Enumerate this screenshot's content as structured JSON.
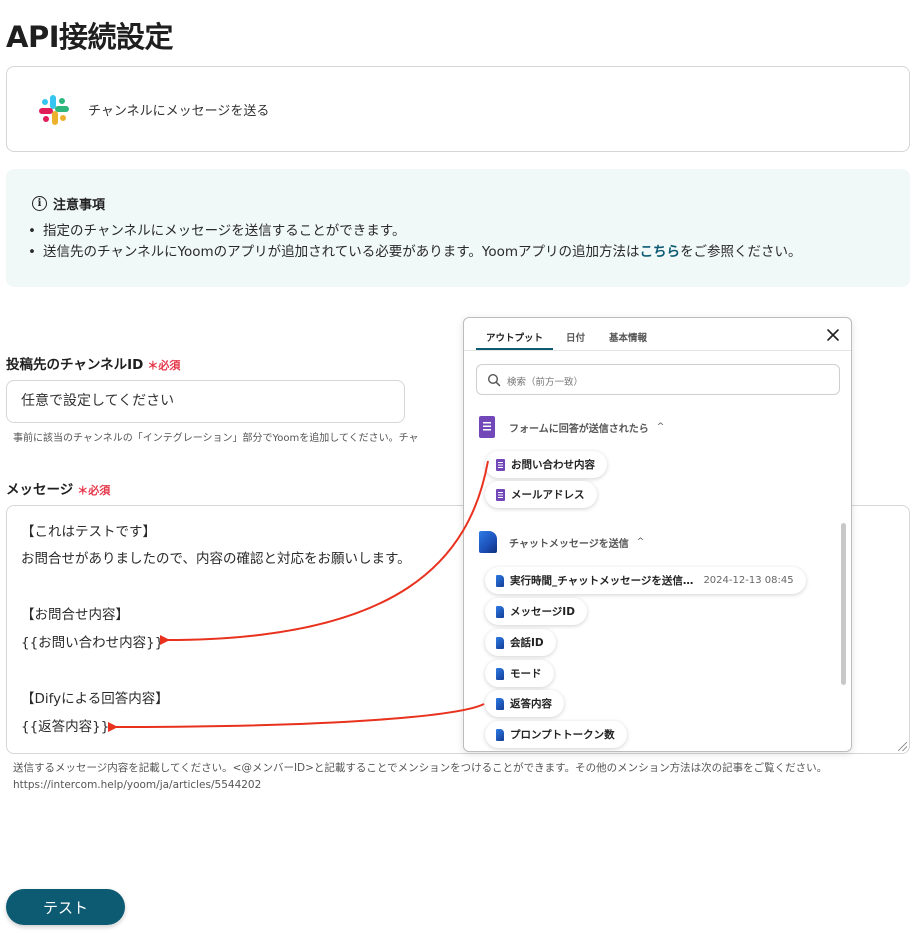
{
  "page": {
    "title": "API接続設定"
  },
  "action": {
    "label": "チャンネルにメッセージを送る",
    "logo": "slack-logo"
  },
  "notice": {
    "title": "注意事項",
    "item1": "指定のチャンネルにメッセージを送信することができます。",
    "item2_before": "送信先のチャンネルにYoomのアプリが追加されている必要があります。Yoomアプリの追加方法は",
    "item2_link": "こちら",
    "item2_after": "をご参照ください。"
  },
  "channel_field": {
    "label": "投稿先のチャンネルID",
    "required": "必須",
    "value": "任意で設定してください",
    "help": "事前に該当のチャンネルの「インテグレーション」部分でYoomを追加してください。チャ"
  },
  "message_field": {
    "label": "メッセージ",
    "required": "必須",
    "lines": [
      "【これはテストです】",
      "お問合せがありましたので、内容の確認と対応をお願いします。",
      "【お問合せ内容】",
      "{{お問い合わせ内容}}",
      "【Difyによる回答内容】",
      "{{返答内容}}"
    ],
    "help1": "送信するメッセージ内容を記載してください。<@メンバーID>と記載することでメンションをつけることができます。その他のメンション方法は次の記事をご覧ください。",
    "help2": "https://intercom.help/yoom/ja/articles/5544202"
  },
  "test_button": {
    "label": "テスト"
  },
  "picker": {
    "tabs": [
      "アウトプット",
      "日付",
      "基本情報"
    ],
    "search_placeholder": "検索（前方一致）",
    "sections": [
      {
        "title": "フォームに回答が送信されたら",
        "chevron": "^",
        "items": [
          {
            "label": "お問い合わせ内容"
          },
          {
            "label": "メールアドレス"
          }
        ]
      },
      {
        "title": "チャットメッセージを送信",
        "chevron": "^",
        "items": [
          {
            "label": "実行時間_チャットメッセージを送信…",
            "value": "2024-12-13 08:45"
          },
          {
            "label": "メッセージID"
          },
          {
            "label": "会話ID"
          },
          {
            "label": "モード"
          },
          {
            "label": "返答内容"
          },
          {
            "label": "プロンプトトークン数"
          }
        ]
      }
    ]
  },
  "colors": {
    "accent": "#0d5a73",
    "required": "#e5384b",
    "arrow": "#e8321e",
    "forms": "#7248b9",
    "notice_bg": "#f1f8f8"
  }
}
